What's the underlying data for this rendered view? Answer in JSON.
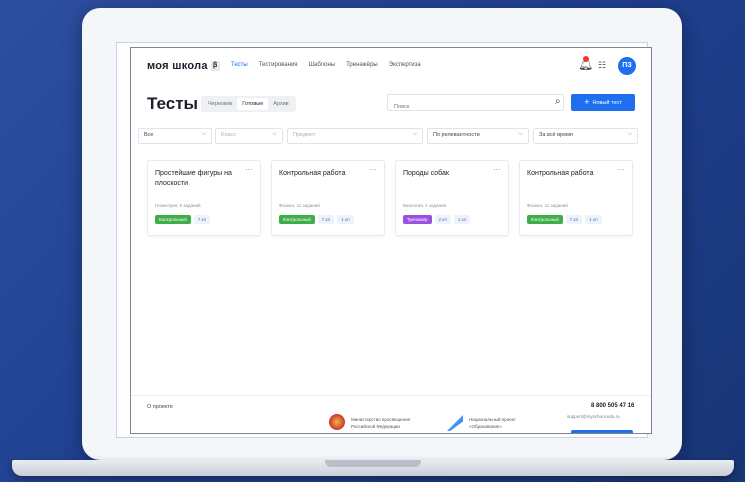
{
  "header": {
    "logo": "моя школа",
    "logo_badge": "β",
    "nav": [
      "Тесты",
      "Тестирования",
      "Шаблоны",
      "Тренажёры",
      "Экспертиза"
    ],
    "avatar": "ПЗ"
  },
  "page": {
    "title": "Тесты",
    "status_tabs": [
      "Черновик",
      "Готовые",
      "Архив"
    ],
    "active_status_tab": "Готовые",
    "search_placeholder": "Поиск",
    "new_button_label": "Новый тест"
  },
  "filters": [
    {
      "value": "Все",
      "placeholder": false
    },
    {
      "value": "Класс",
      "placeholder": true
    },
    {
      "value": "Предмет",
      "placeholder": true
    },
    {
      "value": "По релевантности",
      "placeholder": false
    },
    {
      "value": "За всё время",
      "placeholder": false
    }
  ],
  "cards": [
    {
      "title": "Простейшие фигуры на плоскости",
      "meta": "Геометрия, 5 заданий",
      "tags": [
        {
          "label": "Контрольный",
          "style": "green"
        },
        {
          "label": "7 кл",
          "style": "light"
        }
      ]
    },
    {
      "title": "Контрольная работа",
      "meta": "Физика, 11 заданий",
      "tags": [
        {
          "label": "Контрольный",
          "style": "green"
        },
        {
          "label": "7 кл",
          "style": "light"
        },
        {
          "label": "1 кл",
          "style": "light"
        }
      ]
    },
    {
      "title": "Породы собак",
      "meta": "Биология, 4 задания",
      "tags": [
        {
          "label": "Тренажёр",
          "style": "purple"
        },
        {
          "label": "2 кл",
          "style": "light"
        },
        {
          "label": "1 кл",
          "style": "light"
        }
      ]
    },
    {
      "title": "Контрольная работа",
      "meta": "Физика, 11 заданий",
      "tags": [
        {
          "label": "Контрольный",
          "style": "green"
        },
        {
          "label": "7 кл",
          "style": "light"
        },
        {
          "label": "1 кл",
          "style": "light"
        }
      ]
    }
  ],
  "footer": {
    "about": "О проекте",
    "ministry": "Министерство просвещения Российской Федерации",
    "project": "Национальный проект «Образование»",
    "phone": "8 800 505 47 16",
    "email": "support@myschool.edu.ru"
  },
  "colors": {
    "accent": "#1e6ff0",
    "green_tag": "#3fae49",
    "purple_tag": "#9b51e0",
    "background": "#2e4fa0"
  }
}
